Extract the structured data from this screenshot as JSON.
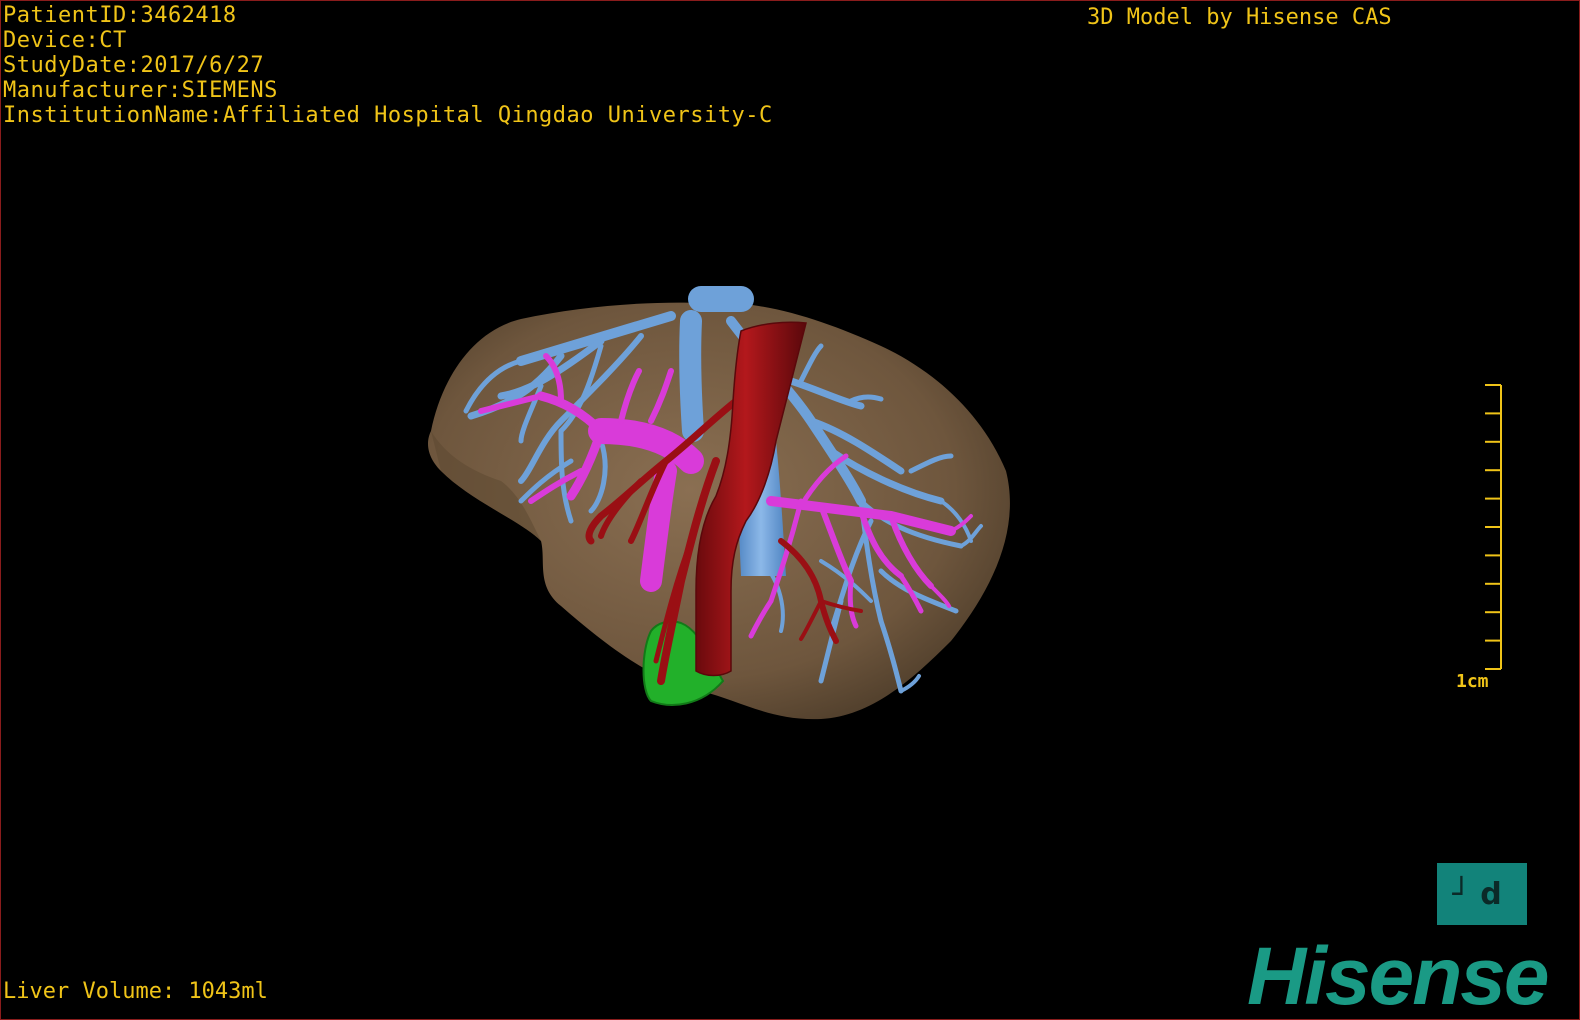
{
  "study_info": {
    "patient_id": "PatientID:3462418",
    "device": "Device:CT",
    "study_date": "StudyDate:2017/6/27",
    "manufacturer": "Manufacturer:SIEMENS",
    "institution": "InstitutionName:Affiliated Hospital Qingdao University-C"
  },
  "credit": "3D Model by Hisense CAS",
  "liver_volume": "Liver Volume: 1043ml",
  "scale_bar": {
    "label": "1cm",
    "ticks": 10
  },
  "orientation_marker": "┘d",
  "logo": "Hisense",
  "colors": {
    "text": "#f0c418",
    "liver": "#7a6247",
    "hepatic_vein": "#6ea1d9",
    "portal_vein": "#d93bd9",
    "artery": "#9a0f14",
    "gallbladder": "#22b02a",
    "brand": "#1a9a85"
  },
  "structures": [
    "liver-surface",
    "hepatic-vein",
    "portal-vein",
    "hepatic-artery",
    "gallbladder"
  ]
}
